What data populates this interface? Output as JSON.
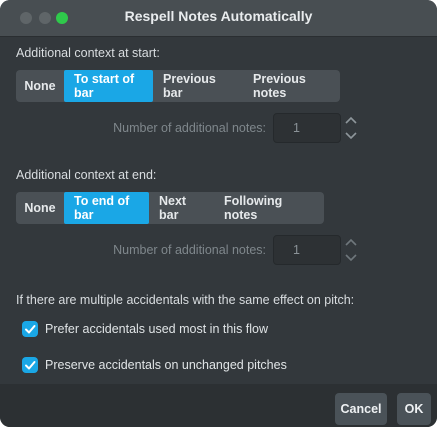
{
  "window": {
    "title": "Respell Notes Automatically"
  },
  "start": {
    "label": "Additional context at start:",
    "options": [
      "None",
      "To start of bar",
      "Previous bar",
      "Previous notes"
    ],
    "selected": "To start of bar",
    "number_label": "Number of additional notes:",
    "number_value": "1"
  },
  "end": {
    "label": "Additional context at end:",
    "options": [
      "None",
      "To end of bar",
      "Next bar",
      "Following notes"
    ],
    "selected": "To end of bar",
    "number_label": "Number of additional notes:",
    "number_value": "1"
  },
  "accidentals": {
    "label": "If there are multiple accidentals with the same effect on pitch:",
    "options": [
      {
        "label": "Prefer accidentals used most in this flow",
        "checked": true
      },
      {
        "label": "Preserve accidentals on unchanged pitches",
        "checked": true
      }
    ]
  },
  "buttons": {
    "cancel": "Cancel",
    "ok": "OK"
  },
  "colors": {
    "accent": "#1aa7e6",
    "background": "#33383c",
    "maximize": "#2fc94b"
  }
}
